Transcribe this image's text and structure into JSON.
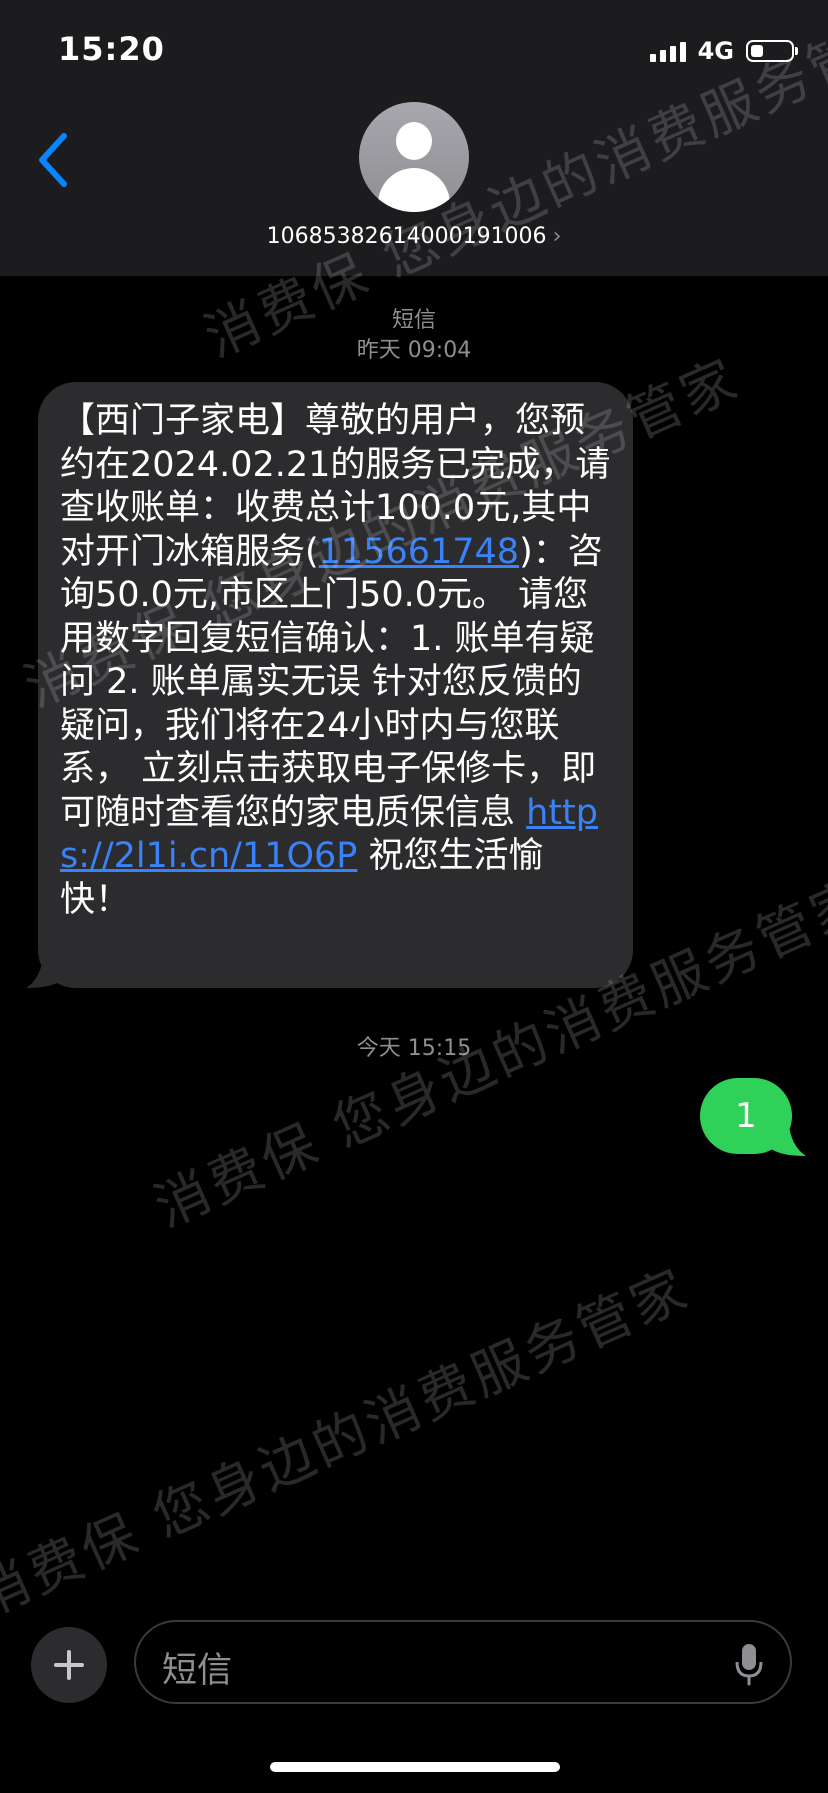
{
  "status": {
    "time": "15:20",
    "network": "4G"
  },
  "header": {
    "contact_number": "10685382614000191006",
    "chevron": "›"
  },
  "thread": {
    "first_label_title": "短信",
    "first_label_time": "昨天 09:04",
    "second_label": "今天 15:15"
  },
  "incoming_message": {
    "text_part1": "【西门子家电】尊敬的用户，您预约在2024.02.21的服务已完成，请查收账单：收费总计100.0元,其中对开门冰箱服务(",
    "link_order": "115661748",
    "text_part2": ")：咨询50.0元,市区上门50.0元。 请您用数字回复短信确认：1. 账单有疑问 2. 账单属实无误 针对您反馈的疑问，我们将在24小时内与您联系， 立刻点击获取电子保修卡，即可随时查看您的家电质保信息 ",
    "link_url": "https://2l1i.cn/11O6P",
    "text_part3": " 祝您生活愉快！"
  },
  "outgoing_message": {
    "text": "1"
  },
  "composer": {
    "placeholder": "短信"
  },
  "watermarks": [
    "消费保 您身边的消费服务管家"
  ],
  "colors": {
    "incoming_bubble": "#2c2c2e",
    "outgoing_bubble": "#30d158",
    "link": "#3a82f7",
    "accent": "#0a84ff"
  },
  "icons": {
    "back": "chevron-left-icon",
    "add": "plus-icon",
    "mic": "microphone-icon",
    "avatar": "person-icon"
  }
}
